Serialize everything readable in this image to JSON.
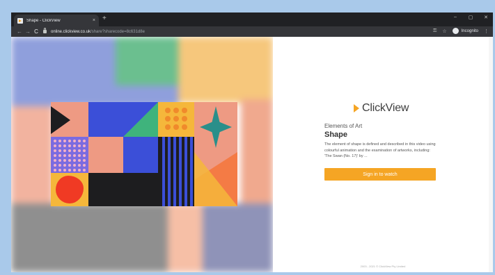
{
  "browser": {
    "tab_title": "Shape - ClickView",
    "tab_close": "×",
    "new_tab": "+",
    "controls": {
      "minimize": "–",
      "maximize": "▢",
      "close": "✕"
    },
    "nav": {
      "back": "←",
      "forward": "→",
      "reload": "C"
    },
    "url_host": "online.clickview.co.uk",
    "url_path": "/share?sharecode=8c631d8e",
    "icons": {
      "key": "⚿",
      "star": "☆",
      "menu": "⋮"
    },
    "incognito_label": "Incognito"
  },
  "video": {
    "title_prefix": "Elements of Art",
    "title": "Shape",
    "description": "The element of shape is defined and described in this video using colourful animation and the examination of artworks, including: 'The Swan (No. 17)' by ...",
    "cta_label": "Sign in to watch"
  },
  "brand": {
    "name": "ClickView",
    "accent": "#f5a524"
  },
  "footer": "2003 - 2021 © ClickView Pty Limited",
  "colors": {
    "coral": "#ee9a83",
    "blue": "#3b4fd8",
    "green": "#3fb37c",
    "yellow": "#f5b73b",
    "teal": "#2a8f8a",
    "black": "#1d1d1f",
    "red": "#f03a24",
    "orange": "#f47b45"
  }
}
